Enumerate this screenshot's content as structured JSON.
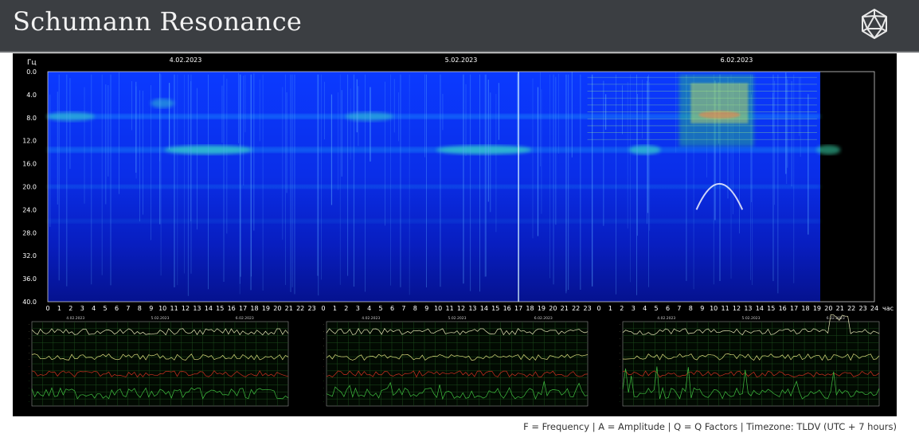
{
  "header": {
    "title": "Schumann Resonance",
    "logo_icon": "icosahedron-icon"
  },
  "spectrogram": {
    "unit_label": "Гц",
    "hours_unit": "час",
    "dates": [
      "4.02.2023",
      "5.02.2023",
      "6.02.2023"
    ],
    "freq_ticks": [
      "0.0",
      "4.0",
      "8.0",
      "12.0",
      "16.0",
      "20.0",
      "24.0",
      "28.0",
      "32.0",
      "36.0",
      "40.0"
    ],
    "hour_ticks": [
      "0",
      "1",
      "2",
      "3",
      "4",
      "5",
      "6",
      "7",
      "8",
      "9",
      "10",
      "11",
      "12",
      "13",
      "14",
      "15",
      "16",
      "17",
      "18",
      "19",
      "20",
      "21",
      "22",
      "23",
      "24"
    ],
    "colors": {
      "background": "#000000",
      "low": "#0a10b0",
      "mid": "#1a5cff",
      "band": "#20d0ff",
      "hot": "#ffff40"
    }
  },
  "mini_charts": [
    {
      "name": "Frequency",
      "dates": [
        "4.02.2023",
        "5.02.2023",
        "6.02.2023"
      ],
      "series_colors": [
        "#e8e8b8",
        "#e0e080",
        "#d03020",
        "#40c040"
      ]
    },
    {
      "name": "Amplitude",
      "dates": [
        "4.02.2023",
        "5.02.2023",
        "6.02.2023"
      ],
      "series_colors": [
        "#e8e8b8",
        "#e0e080",
        "#d03020",
        "#40c040"
      ]
    },
    {
      "name": "Q Factors",
      "dates": [
        "4.02.2023",
        "5.02.2023",
        "6.02.2023"
      ],
      "series_colors": [
        "#e8e8b8",
        "#e0e080",
        "#d03020",
        "#40c040"
      ]
    }
  ],
  "caption": "F = Frequency | A = Amplitude | Q = Q Factors | Timezone: TLDV (UTC + 7 hours)"
}
